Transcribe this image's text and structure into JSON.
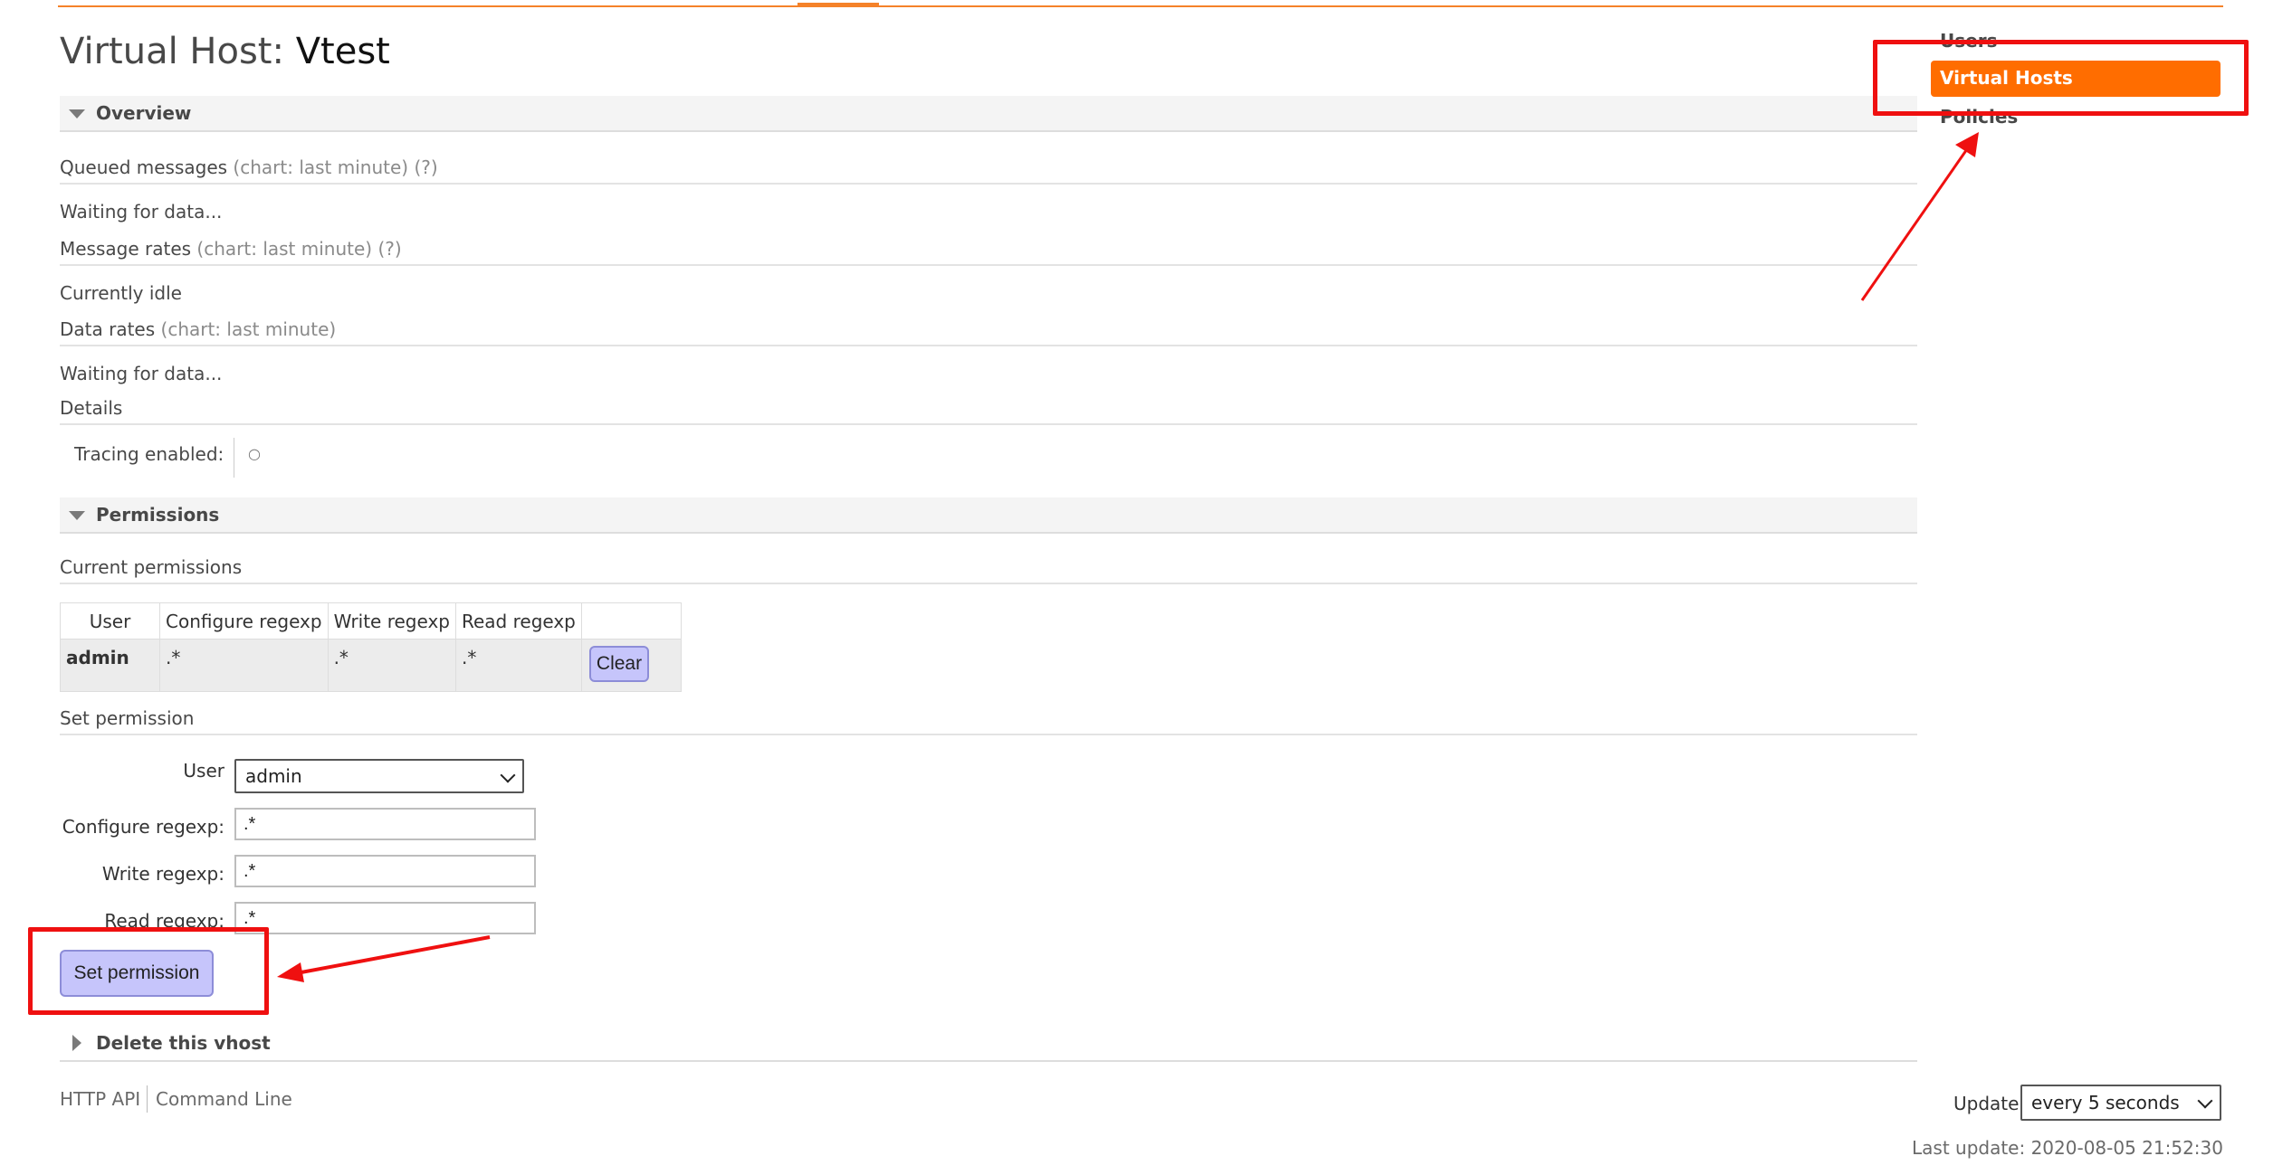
{
  "header": {
    "title_prefix": "Virtual Host:",
    "vhost_name": "Vtest"
  },
  "overview": {
    "heading": "Overview",
    "queued_messages": {
      "label": "Queued messages",
      "hint": "(chart: last minute) (?)",
      "status": "Waiting for data..."
    },
    "message_rates": {
      "label": "Message rates",
      "hint": "(chart: last minute) (?)",
      "status": "Currently idle"
    },
    "data_rates": {
      "label": "Data rates",
      "hint": "(chart: last minute)",
      "status": "Waiting for data..."
    },
    "details": {
      "label": "Details",
      "tracing_label": "Tracing enabled:",
      "tracing_value": "○"
    }
  },
  "permissions": {
    "heading": "Permissions",
    "current_label": "Current permissions",
    "table": {
      "columns": [
        "User",
        "Configure regexp",
        "Write regexp",
        "Read regexp",
        ""
      ],
      "rows": [
        {
          "user": "admin",
          "configure": ".*",
          "write": ".*",
          "read": ".*",
          "action": "Clear"
        }
      ]
    },
    "set_label": "Set permission",
    "form": {
      "user_label": "User",
      "user_value": "admin",
      "configure_label": "Configure regexp:",
      "configure_value": ".*",
      "write_label": "Write regexp:",
      "write_value": ".*",
      "read_label": "Read regexp:",
      "read_value": ".*",
      "submit_label": "Set permission"
    }
  },
  "delete_section": {
    "heading": "Delete this vhost"
  },
  "footer": {
    "links": [
      "HTTP API",
      "Command Line"
    ],
    "update_label": "Update",
    "update_value": "every 5 seconds",
    "last_update": "Last update: 2020-08-05 21:52:30"
  },
  "sidebar": {
    "items": [
      {
        "label": "Users",
        "active": false
      },
      {
        "label": "Virtual Hosts",
        "active": true
      },
      {
        "label": "Policies",
        "active": false
      }
    ]
  },
  "colors": {
    "accent": "#ff6d00",
    "button": "#c6c5fb",
    "annotation": "#ef1010"
  }
}
